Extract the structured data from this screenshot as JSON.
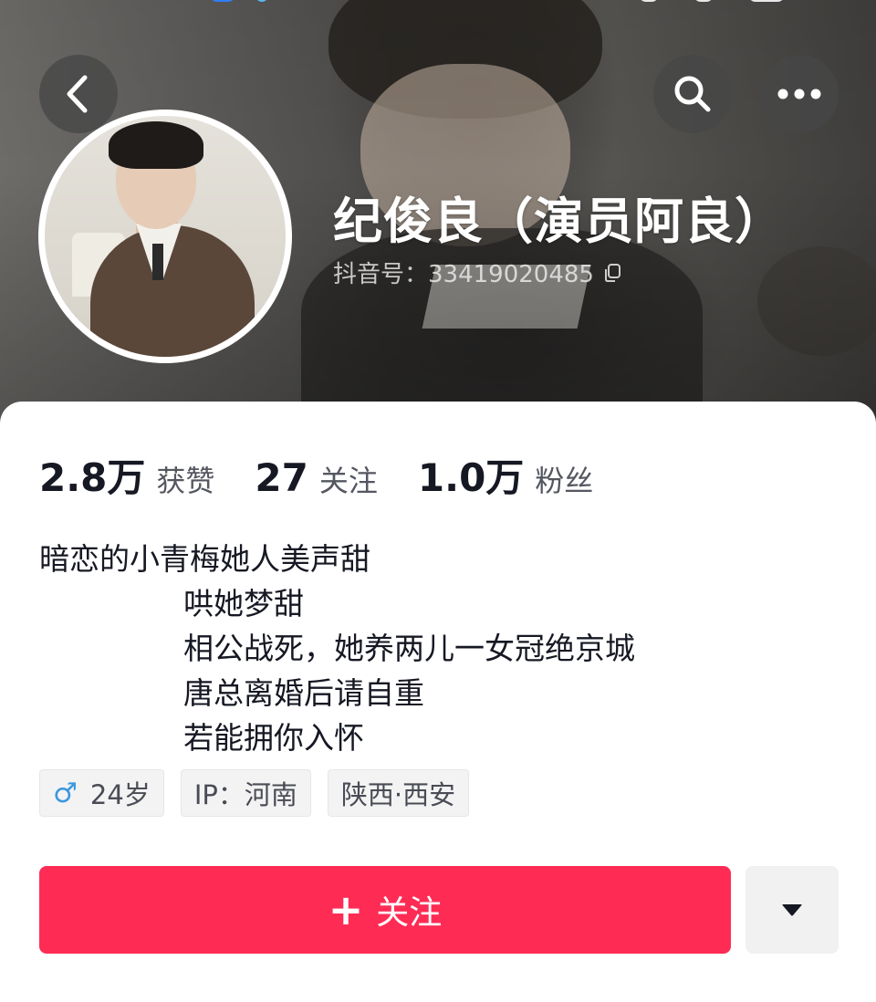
{
  "header": {
    "back_icon": "chevron-left-icon",
    "search_icon": "search-icon",
    "more_icon": "more-horizontal-icon"
  },
  "profile": {
    "name": "纪俊良（演员阿良）",
    "douyin_id": "抖音号：33419020485",
    "copy_icon": "copy-icon"
  },
  "stats": [
    {
      "value": "2.8万",
      "label": "获赞"
    },
    {
      "value": "27",
      "label": "关注"
    },
    {
      "value": "1.0万",
      "label": "粉丝"
    }
  ],
  "bio": {
    "lines": [
      "暗恋的小青梅她人美声甜",
      "哄她梦甜",
      "相公战死，她养两儿一女冠绝京城",
      "唐总离婚后请自重",
      "若能拥你入怀"
    ]
  },
  "tags": {
    "gender_icon": "♂",
    "age": "24岁",
    "ip": "IP：河南",
    "location": "陕西·西安"
  },
  "actions": {
    "follow_plus": "+",
    "follow_label": "关注",
    "dropdown_icon": "caret-down-icon"
  },
  "colors": {
    "accent": "#fe2c55",
    "text_primary": "#161823",
    "text_secondary": "#555760",
    "male": "#3a98dc"
  }
}
